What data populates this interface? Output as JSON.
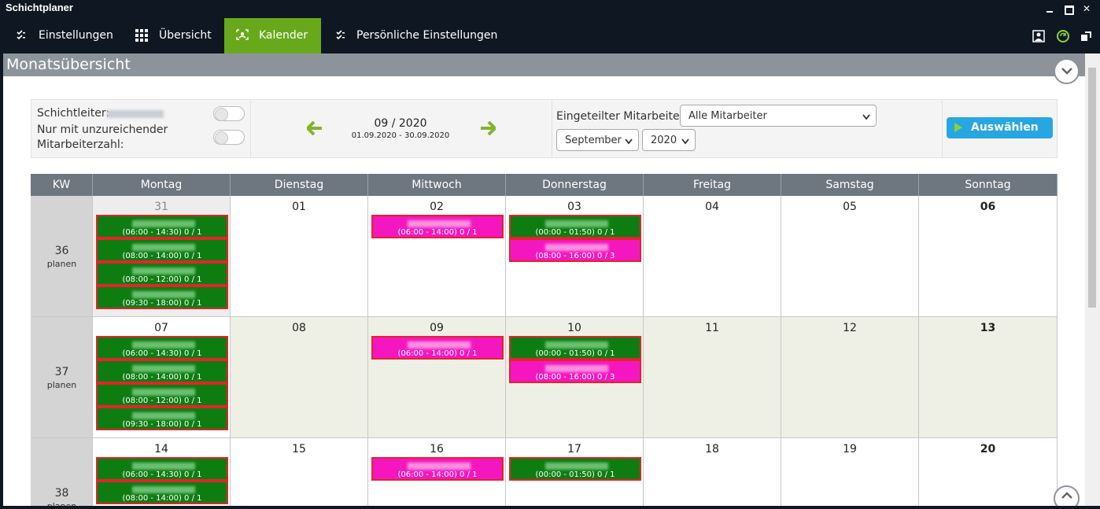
{
  "window": {
    "title": "Schichtplaner"
  },
  "nav": {
    "items": [
      {
        "label": "Einstellungen",
        "icon": "checklist-icon"
      },
      {
        "label": "Übersicht",
        "icon": "grid-icon"
      },
      {
        "label": "Kalender",
        "icon": "calendar-icon",
        "active": true
      },
      {
        "label": "Persönliche Einstellungen",
        "icon": "checklist-icon"
      }
    ],
    "right_icons": [
      "user-badge-icon",
      "refresh-icon",
      "restore-window-icon"
    ]
  },
  "page": {
    "title": "Monatsübersicht"
  },
  "filter": {
    "shift_leader_label": "Schichtleiter:",
    "insufficient_label_1": "Nur mit unzureichender",
    "insufficient_label_2": "Mitarbeiterzahl:",
    "period": "09 / 2020",
    "range": "01.09.2020 - 30.09.2020",
    "employee_label": "Eingeteilter Mitarbeiter:",
    "employee_value": "Alle Mitarbeiter",
    "month_value": "September",
    "year_value": "2020",
    "select_button": "Auswählen"
  },
  "calendar": {
    "headers": [
      "KW",
      "Montag",
      "Dienstag",
      "Mittwoch",
      "Donnerstag",
      "Freitag",
      "Samstag",
      "Sonntag"
    ],
    "plan_label": "planen",
    "weeks": [
      {
        "kw": "36",
        "days": [
          "31",
          "01",
          "02",
          "03",
          "04",
          "05",
          "06"
        ],
        "shifts": [
          [
            {
              "time": "(06:00 - 14:30) 0 / 1",
              "color": "green"
            },
            {
              "time": "(08:00 - 14:00) 0 / 1",
              "color": "green"
            },
            {
              "time": "(08:00 - 12:00) 0 / 1",
              "color": "green"
            },
            {
              "time": "(09:30 - 18:00) 0 / 1",
              "color": "green"
            }
          ],
          [],
          [
            {
              "time": "(06:00 - 14:00) 0 / 1",
              "color": "pink"
            }
          ],
          [
            {
              "time": "(00:00 - 01:50) 0 / 1",
              "color": "green"
            },
            {
              "time": "(08:00 - 16:00) 0 / 3",
              "color": "pink"
            }
          ],
          [],
          [],
          []
        ]
      },
      {
        "kw": "37",
        "days": [
          "07",
          "08",
          "09",
          "10",
          "11",
          "12",
          "13"
        ],
        "shifts": [
          [
            {
              "time": "(06:00 - 14:30) 0 / 1",
              "color": "green"
            },
            {
              "time": "(08:00 - 14:00) 0 / 1",
              "color": "green"
            },
            {
              "time": "(08:00 - 12:00) 0 / 1",
              "color": "green"
            },
            {
              "time": "(09:30 - 18:00) 0 / 1",
              "color": "green"
            }
          ],
          [],
          [
            {
              "time": "(06:00 - 14:00) 0 / 1",
              "color": "pink"
            }
          ],
          [
            {
              "time": "(00:00 - 01:50) 0 / 1",
              "color": "green"
            },
            {
              "time": "(08:00 - 16:00) 0 / 3",
              "color": "pink"
            }
          ],
          [],
          [],
          []
        ]
      },
      {
        "kw": "38",
        "days": [
          "14",
          "15",
          "16",
          "17",
          "18",
          "19",
          "20"
        ],
        "shifts": [
          [
            {
              "time": "(06:00 - 14:30) 0 / 1",
              "color": "green"
            },
            {
              "time": "(08:00 - 14:00) 0 / 1",
              "color": "green"
            }
          ],
          [],
          [
            {
              "time": "(06:00 - 14:00) 0 / 1",
              "color": "pink"
            }
          ],
          [
            {
              "time": "(00:00 - 01:50) 0 / 1",
              "color": "green"
            }
          ],
          [],
          [],
          []
        ]
      }
    ]
  },
  "colors": {
    "nav_active": "#68a91c",
    "shift_green": "#0d7d12",
    "shift_pink": "#f417c0",
    "shift_border": "#e2242a",
    "button": "#26a7e1"
  }
}
